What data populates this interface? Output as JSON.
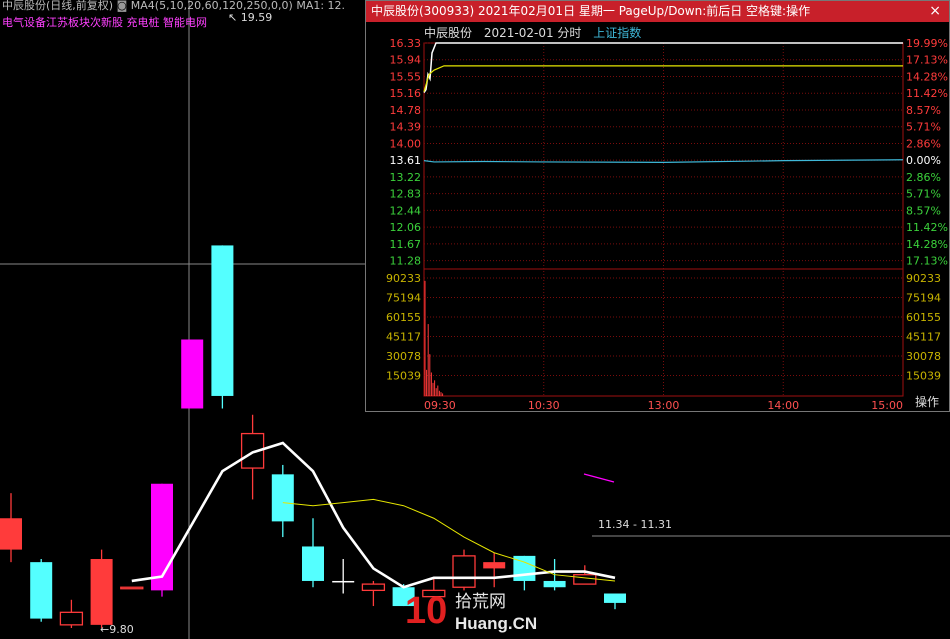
{
  "main_chart": {
    "header_text": "中辰股份(日线,前复权)",
    "indicator_text": "MA4(5,10,20,60,120,250,0,0)  MA1: 12.",
    "sector_text": "电气设备江苏板块次新股 充电桩 智能电网",
    "high_label": "19.59",
    "low_label": "9.80",
    "range_label": "11.34 - 11.31",
    "candles": [
      {
        "o": 11.55,
        "c": 11.05,
        "h": 11.95,
        "l": 10.85,
        "color": "red"
      },
      {
        "o": 10.85,
        "c": 9.95,
        "h": 10.9,
        "l": 9.9,
        "color": "cyan"
      },
      {
        "o": 9.85,
        "c": 10.05,
        "h": 10.25,
        "l": 9.8,
        "color": "red"
      },
      {
        "o": 10.9,
        "c": 9.85,
        "h": 11.05,
        "l": 9.8,
        "color": "red"
      },
      {
        "o": 10.45,
        "c": 10.45,
        "h": 10.45,
        "l": 10.45,
        "color": "red"
      },
      {
        "o": 10.4,
        "c": 12.1,
        "h": 12.1,
        "l": 10.3,
        "color": "magenta"
      },
      {
        "o": 13.3,
        "c": 14.4,
        "h": 14.4,
        "l": 13.3,
        "color": "magenta"
      },
      {
        "o": 15.9,
        "c": 13.5,
        "h": 15.9,
        "l": 13.3,
        "color": "cyan"
      },
      {
        "o": 12.35,
        "c": 12.9,
        "h": 13.2,
        "l": 11.85,
        "color": "red"
      },
      {
        "o": 12.25,
        "c": 11.5,
        "h": 12.4,
        "l": 11.25,
        "color": "cyan"
      },
      {
        "o": 11.1,
        "c": 10.55,
        "h": 11.55,
        "l": 10.45,
        "color": "cyan"
      },
      {
        "o": 10.55,
        "c": 10.55,
        "h": 10.9,
        "l": 10.35,
        "color": "white"
      },
      {
        "o": 10.4,
        "c": 10.5,
        "h": 10.55,
        "l": 10.15,
        "color": "red"
      },
      {
        "o": 10.45,
        "c": 10.15,
        "h": 10.5,
        "l": 10.15,
        "color": "cyan"
      },
      {
        "o": 10.3,
        "c": 10.4,
        "h": 10.6,
        "l": 10.3,
        "color": "red"
      },
      {
        "o": 10.45,
        "c": 10.95,
        "h": 11.05,
        "l": 10.4,
        "color": "red"
      },
      {
        "o": 10.85,
        "c": 10.75,
        "h": 11.0,
        "l": 10.45,
        "color": "red"
      },
      {
        "o": 10.95,
        "c": 10.55,
        "h": 10.95,
        "l": 10.4,
        "color": "cyan"
      },
      {
        "o": 10.55,
        "c": 10.45,
        "h": 10.9,
        "l": 10.4,
        "color": "cyan"
      },
      {
        "o": 10.5,
        "c": 10.65,
        "h": 10.8,
        "l": 10.5,
        "color": "red"
      },
      {
        "o": 10.35,
        "c": 10.2,
        "h": 10.35,
        "l": 10.1,
        "color": "cyan"
      }
    ],
    "ma_white": [
      null,
      null,
      null,
      null,
      10.55,
      10.62,
      null,
      12.3,
      12.6,
      12.75,
      12.3,
      11.4,
      10.75,
      10.45,
      10.6,
      10.6,
      10.6,
      10.65,
      10.7,
      10.7,
      10.6
    ],
    "ma_yellow": [
      null,
      null,
      null,
      null,
      null,
      null,
      null,
      null,
      null,
      11.8,
      11.75,
      11.8,
      11.85,
      11.75,
      11.55,
      11.25,
      11.0,
      10.85,
      10.65,
      10.6,
      10.55
    ]
  },
  "popup": {
    "title": "中辰股份(300933)  2021年02月01日  星期一  PageUp/Down:前后日  空格键:操作",
    "close_label": "×",
    "sub_name": "中辰股份",
    "sub_date": "2021-02-01 分时",
    "sub_index": "上证指数",
    "op_label": "操作",
    "price_ticks": [
      "16.33",
      "15.94",
      "15.55",
      "15.16",
      "14.78",
      "14.39",
      "14.00",
      "13.61",
      "13.22",
      "12.83",
      "12.44",
      "12.06",
      "11.67",
      "11.28"
    ],
    "pct_ticks": [
      "19.99%",
      "17.13%",
      "14.28%",
      "11.42%",
      "8.57%",
      "5.71%",
      "2.86%",
      "0.00%",
      "2.86%",
      "5.71%",
      "8.57%",
      "11.42%",
      "14.28%",
      "17.13%"
    ],
    "vol_ticks": [
      "90233",
      "75194",
      "60155",
      "45117",
      "30078",
      "15039"
    ],
    "time_ticks": [
      "09:30",
      "10:30",
      "13:00",
      "14:00",
      "15:00"
    ],
    "colors": {
      "up": "#ff3b3b",
      "down": "#3bd13b",
      "flat": "#ffffff",
      "vol": "#c8b400"
    }
  }
}
